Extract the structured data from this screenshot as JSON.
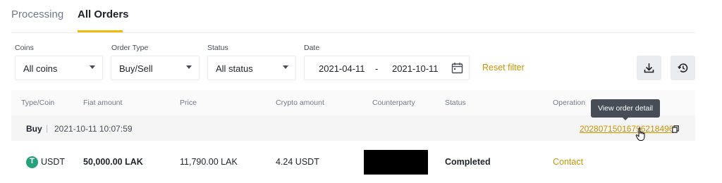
{
  "tabs": [
    "Processing",
    "All Orders"
  ],
  "filters": {
    "coins": {
      "label": "Coins",
      "value": "All coins"
    },
    "order_type": {
      "label": "Order Type",
      "value": "Buy/Sell"
    },
    "status": {
      "label": "Status",
      "value": "All status"
    },
    "date": {
      "label": "Date",
      "from": "2021-04-11",
      "separator": "-",
      "to": "2021-10-11"
    },
    "reset_label": "Reset filter"
  },
  "icons": {
    "caret": "chevron-down-icon",
    "calendar": "calendar-icon",
    "download": "download-icon",
    "history": "history-icon",
    "copy": "copy-icon",
    "tether": "tether-icon",
    "cursor": "hand-cursor-icon"
  },
  "table": {
    "columns": [
      "Type/Coin",
      "Fiat amount",
      "Price",
      "Crypto amount",
      "Counterparty",
      "Status",
      "Operation"
    ],
    "tooltip": "View order detail",
    "group": {
      "side": "Buy",
      "separator": "|",
      "time": "2021-10-11 10:07:59",
      "order_number": "20280715016796218496"
    },
    "row": {
      "coin_symbol": "T",
      "coin": "USDT",
      "fiat_amount": "50,000.00 LAK",
      "price": "11,790.00 LAK",
      "crypto_amount": "4.24 USDT",
      "status": "Completed",
      "operation": "Contact"
    }
  },
  "colors": {
    "accent": "#f0b90b",
    "link": "#c99400",
    "tether": "#26a17b",
    "tooltip_bg": "#474d57"
  }
}
